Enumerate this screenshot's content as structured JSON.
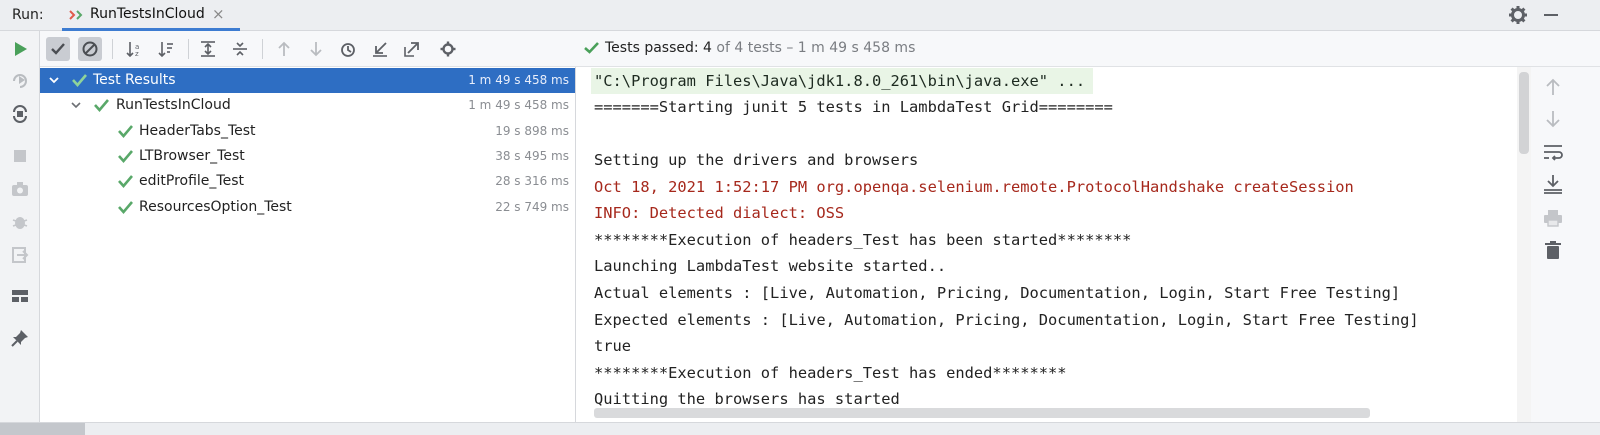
{
  "runbar": {
    "label": "Run:",
    "tab_title": "RunTestsInCloud",
    "tab_close": "×"
  },
  "toolbar": {
    "status_prefix": "Tests passed:",
    "status_count": "4",
    "status_suffix": "of 4 tests – 1 m 49 s 458 ms"
  },
  "tree": {
    "rows": [
      {
        "name": "Test Results",
        "duration": "1 m 49 s 458 ms"
      },
      {
        "name": "RunTestsInCloud",
        "duration": "1 m 49 s 458 ms"
      },
      {
        "name": "HeaderTabs_Test",
        "duration": "19 s 898 ms"
      },
      {
        "name": "LTBrowser_Test",
        "duration": "38 s 495 ms"
      },
      {
        "name": "editProfile_Test",
        "duration": "28 s 316 ms"
      },
      {
        "name": "ResourcesOption_Test",
        "duration": "22 s 749 ms"
      }
    ]
  },
  "console": {
    "lines": [
      "\"C:\\Program Files\\Java\\jdk1.8.0_261\\bin\\java.exe\" ...",
      "=======Starting junit 5 tests in LambdaTest Grid========",
      "",
      "Setting up the drivers and browsers",
      "Oct 18, 2021 1:52:17 PM org.openqa.selenium.remote.ProtocolHandshake createSession",
      "INFO: Detected dialect: OSS",
      "********Execution of headers_Test has been started********",
      "Launching LambdaTest website started..",
      "Actual elements : [Live, Automation, Pricing, Documentation, Login, Start Free Testing]",
      "Expected elements : [Live, Automation, Pricing, Documentation, Login, Start Free Testing]",
      "true",
      "********Execution of headers_Test has ended********",
      "Quitting the browsers has started"
    ]
  },
  "colors": {
    "accent": "#2e6ec3",
    "pass_green": "#59a869",
    "error_red": "#a6281c"
  },
  "icons": {
    "left_toolbar": [
      "rerun-icon",
      "rerun-failed-icon",
      "toggle-auto-test-icon",
      "stop-icon",
      "camera-icon",
      "debug-icon",
      "exit-icon",
      "layout-icon",
      "pin-icon"
    ],
    "main_toolbar": [
      "show-passed-icon",
      "show-ignored-icon",
      "sort-alpha-icon",
      "sort-duration-icon",
      "expand-all-icon",
      "collapse-all-icon",
      "prev-failed-icon",
      "next-failed-icon",
      "history-icon",
      "import-icon",
      "export-icon",
      "settings-icon"
    ],
    "right_toolbar": [
      "scroll-up-icon",
      "scroll-down-icon",
      "soft-wrap-icon",
      "scroll-to-end-icon",
      "print-icon",
      "clear-all-icon"
    ]
  }
}
